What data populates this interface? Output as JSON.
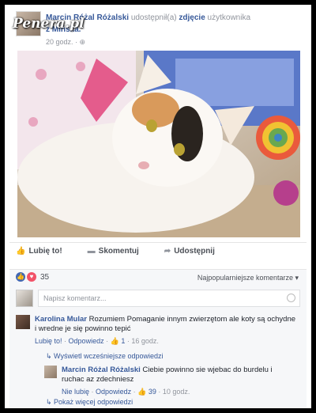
{
  "watermark": "Penera.pl",
  "post": {
    "author": "Marcin Różal Różalski",
    "action_text": "udostępnił(a)",
    "photo_link": "zdjęcie",
    "suffix": "użytkownika",
    "shared_from": "z Mińska.",
    "time": "20 godz. · ⊕"
  },
  "actions": {
    "like": "Lubię to!",
    "comment": "Skomentuj",
    "share": "Udostępnij"
  },
  "reactions": {
    "count": "35",
    "sort_label": "Najpopularniejsze komentarze ▾"
  },
  "comment_input": {
    "placeholder": "Napisz komentarz..."
  },
  "comments": [
    {
      "author": "Karolina Mular",
      "text": "Rozumiem Pomaganie innym zwierzętom ale koty są ochydne i wredne je się powinno tepić",
      "like": "Lubię to!",
      "reply": "Odpowiedz",
      "likes": "1",
      "time": "16 godz."
    }
  ],
  "view_earlier": "↳ Wyświetl wcześniejsze odpowiedzi",
  "reply": {
    "author": "Marcin Różal Różalski",
    "text": "Ciebie powinno sie wjebac do burdelu i ruchac az zdechniesz",
    "unlike": "Nie lubię",
    "reply": "Odpowiedz",
    "likes": "39",
    "time": "10 godz."
  },
  "show_more": "↳ Pokaż więcej odpowiedzi",
  "colors": {
    "link": "#365899",
    "like_blue": "#4267b2",
    "love_red": "#f25268"
  }
}
